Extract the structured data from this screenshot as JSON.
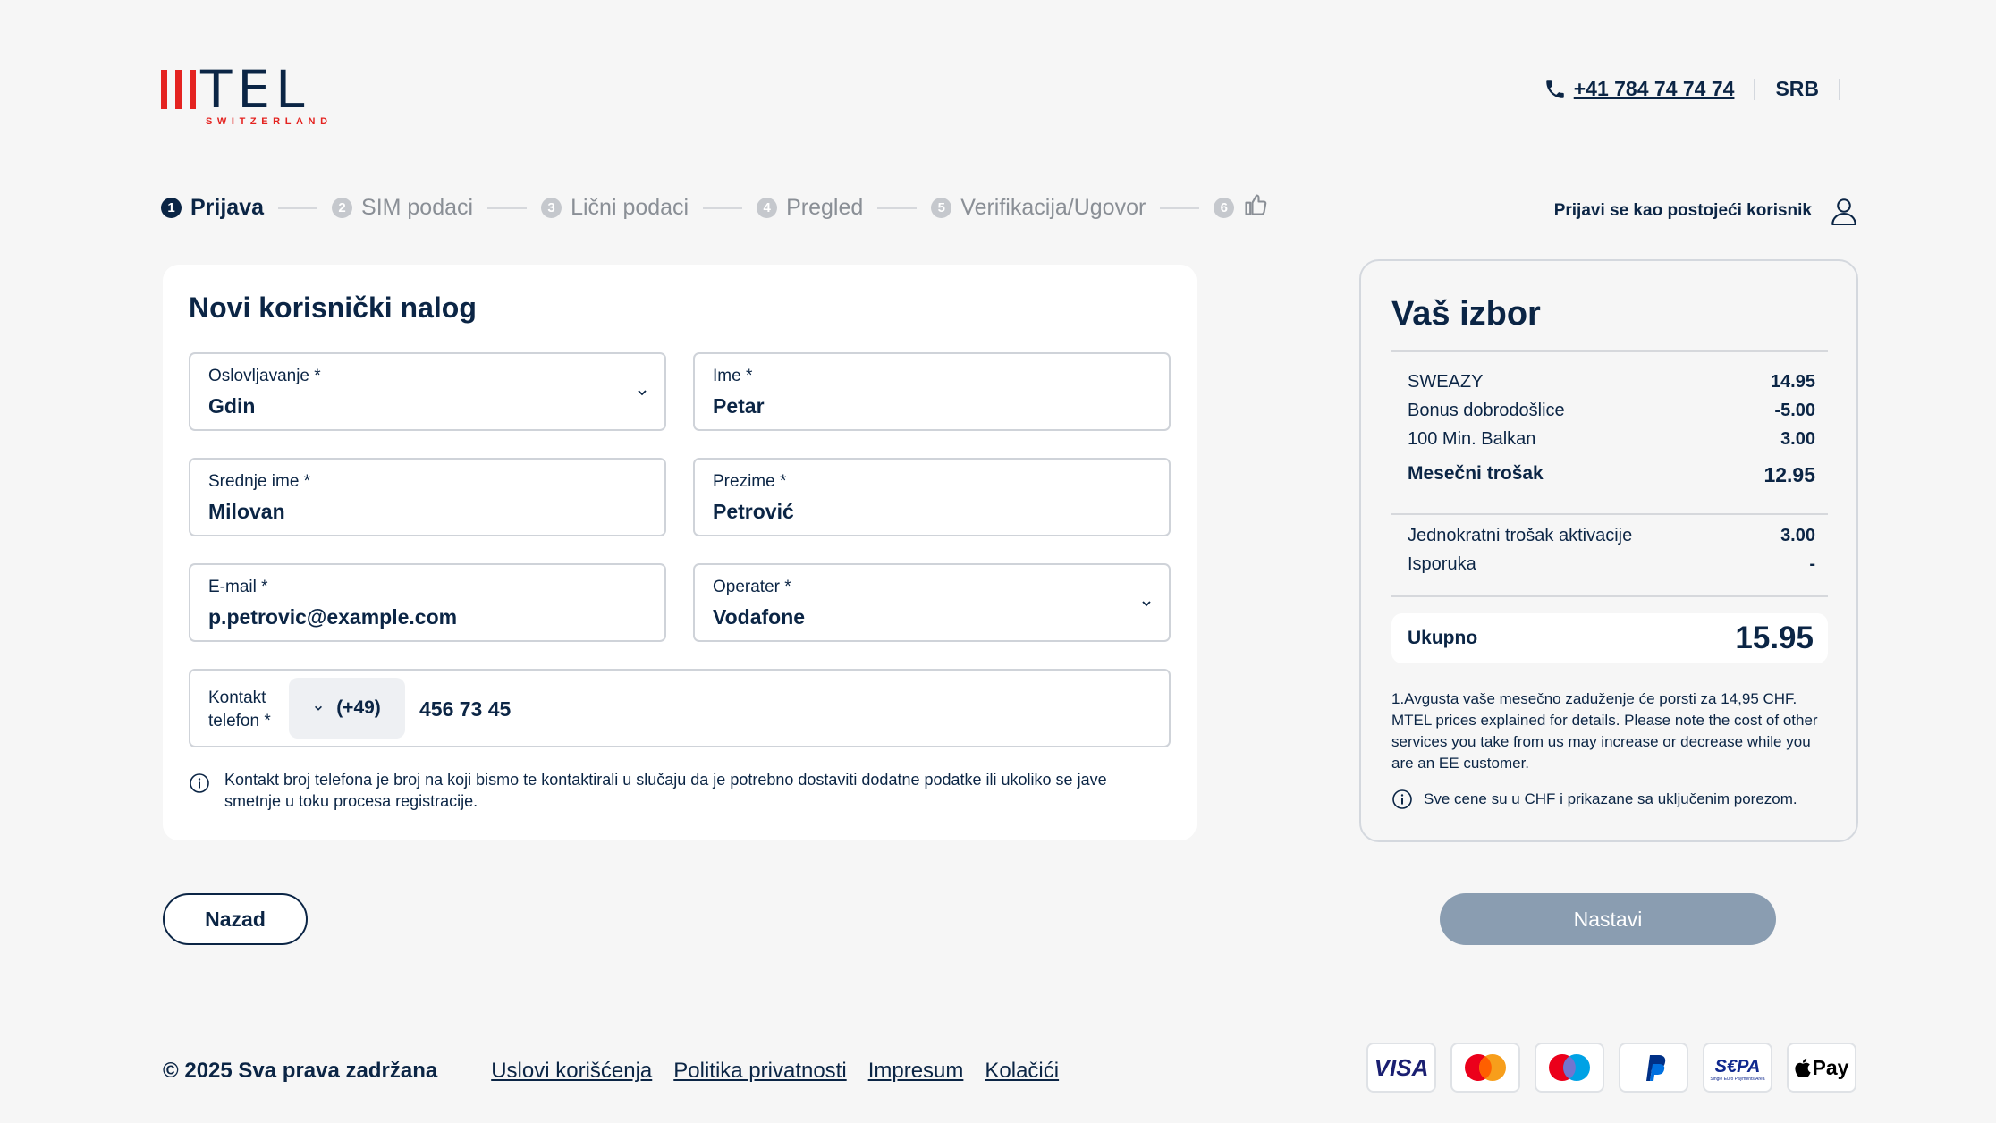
{
  "brand": {
    "wordmark": "TEL",
    "sub": "SWITZERLAND",
    "red": "#e42320",
    "navy": "#0b2545"
  },
  "header": {
    "phone": "+41 784 74 74 74",
    "lang": "SRB"
  },
  "stepper": [
    {
      "num": "1",
      "label": "Prijava",
      "active": true
    },
    {
      "num": "2",
      "label": "SIM podaci"
    },
    {
      "num": "3",
      "label": "Lični podaci"
    },
    {
      "num": "4",
      "label": "Pregled"
    },
    {
      "num": "5",
      "label": "Verifikacija/Ugovor"
    },
    {
      "num": "6",
      "label": ""
    }
  ],
  "login_link": "Prijavi se kao postojeći korisnik",
  "form": {
    "title": "Novi korisnički nalog",
    "salutation": {
      "label": "Oslovljavanje *",
      "value": "Gdin"
    },
    "first_name": {
      "label": "Ime *",
      "value": "Petar"
    },
    "middle_name": {
      "label": "Srednje ime *",
      "value": "Milovan"
    },
    "last_name": {
      "label": "Prezime *",
      "value": "Petrović"
    },
    "email": {
      "label": "E-mail *",
      "value": "p.petrovic@example.com"
    },
    "operator": {
      "label": "Operater *",
      "value": "Vodafone"
    },
    "phone": {
      "label": "Kontakt telefon *",
      "prefix": "(+49)",
      "value": "456 73 45"
    },
    "info": "Kontakt broj telefona je broj na koji bismo te kontaktirali u slučaju da je potrebno dostaviti dodatne podatke ili ukoliko se jave smetnje u toku procesa registracije."
  },
  "summary": {
    "title": "Vaš izbor",
    "rows": [
      {
        "label": "SWEAZY",
        "value": "14.95"
      },
      {
        "label": "Bonus dobrodošlice",
        "value": "-5.00"
      },
      {
        "label": "100 Min. Balkan",
        "value": "3.00"
      }
    ],
    "monthly": {
      "label": "Mesečni trošak",
      "value": "12.95"
    },
    "activation": {
      "label": "Jednokratni trošak aktivacije",
      "value": "3.00"
    },
    "delivery": {
      "label": "Isporuka",
      "value": "-"
    },
    "total": {
      "label": "Ukupno",
      "value": "15.95"
    },
    "note": "1.Avgusta vaše mesečno zaduženje će porsti za 14,95 CHF. MTEL prices explained for details. Please note the cost of other services you take from us may increase or decrease while you are an EE customer.",
    "tax_info": "Sve cene su u CHF i prikazane sa uključenim porezom."
  },
  "buttons": {
    "back": "Nazad",
    "next": "Nastavi"
  },
  "footer": {
    "copyright": "© 2025 Sva prava zadržana",
    "links": [
      "Uslovi korišćenja",
      "Politika privatnosti",
      "Impresum",
      "Kolačići"
    ],
    "payments": [
      "VISA",
      "mastercard",
      "maestro",
      "PayPal",
      "SEPA",
      "Pay"
    ]
  }
}
